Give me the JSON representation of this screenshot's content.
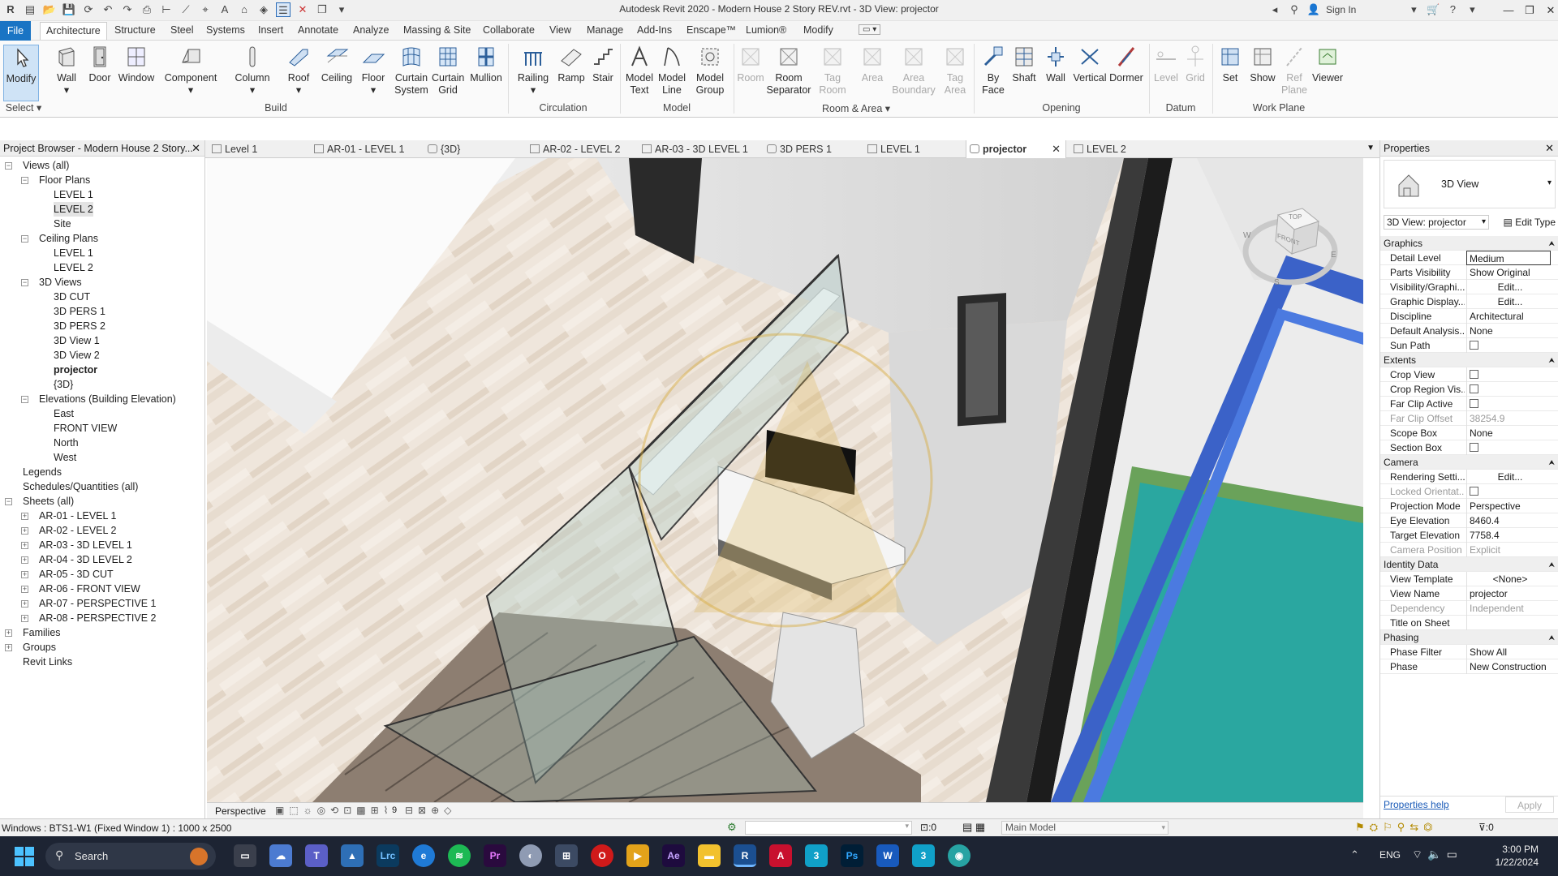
{
  "window": {
    "title": "Autodesk Revit 2020 - Modern House 2 Story REV.rvt - 3D View: projector",
    "sign_in": "Sign In"
  },
  "ribbon_tabs": [
    "File",
    "Architecture",
    "Structure",
    "Steel",
    "Systems",
    "Insert",
    "Annotate",
    "Analyze",
    "Massing & Site",
    "Collaborate",
    "View",
    "Manage",
    "Add-Ins",
    "Enscape™",
    "Lumion®",
    "Modify"
  ],
  "ribbon": {
    "buttons": [
      {
        "label": "Modify",
        "icon": "cursor-icon",
        "enabled": true
      },
      {
        "label": "Wall",
        "icon": "wall-icon",
        "enabled": true
      },
      {
        "label": "Door",
        "icon": "door-icon",
        "enabled": true
      },
      {
        "label": "Window",
        "icon": "window-icon",
        "enabled": true
      },
      {
        "label": "Component",
        "icon": "component-icon",
        "enabled": true
      },
      {
        "label": "Column",
        "icon": "column-icon",
        "enabled": true
      },
      {
        "label": "Roof",
        "icon": "roof-icon",
        "enabled": true
      },
      {
        "label": "Ceiling",
        "icon": "ceiling-icon",
        "enabled": true
      },
      {
        "label": "Floor",
        "icon": "floor-icon",
        "enabled": true
      },
      {
        "label": "Curtain\nSystem",
        "icon": "curtain-system-icon",
        "enabled": true
      },
      {
        "label": "Curtain\nGrid",
        "icon": "curtain-grid-icon",
        "enabled": true
      },
      {
        "label": "Mullion",
        "icon": "mullion-icon",
        "enabled": true
      },
      {
        "label": "Railing",
        "icon": "railing-icon",
        "enabled": true
      },
      {
        "label": "Ramp",
        "icon": "ramp-icon",
        "enabled": true
      },
      {
        "label": "Stair",
        "icon": "stair-icon",
        "enabled": true
      },
      {
        "label": "Model\nText",
        "icon": "model-text-icon",
        "enabled": true
      },
      {
        "label": "Model\nLine",
        "icon": "model-line-icon",
        "enabled": true
      },
      {
        "label": "Model\nGroup",
        "icon": "model-group-icon",
        "enabled": true
      },
      {
        "label": "Room",
        "icon": "room-icon",
        "enabled": false
      },
      {
        "label": "Room\nSeparator",
        "icon": "room-separator-icon",
        "enabled": true
      },
      {
        "label": "Tag\nRoom",
        "icon": "tag-room-icon",
        "enabled": false
      },
      {
        "label": "Area",
        "icon": "area-icon",
        "enabled": false
      },
      {
        "label": "Area\nBoundary",
        "icon": "area-boundary-icon",
        "enabled": false
      },
      {
        "label": "Tag\nArea",
        "icon": "tag-area-icon",
        "enabled": false
      },
      {
        "label": "By\nFace",
        "icon": "by-face-icon",
        "enabled": true
      },
      {
        "label": "Shaft",
        "icon": "shaft-icon",
        "enabled": true
      },
      {
        "label": "Wall",
        "icon": "wall-opening-icon",
        "enabled": true
      },
      {
        "label": "Vertical",
        "icon": "vertical-icon",
        "enabled": true
      },
      {
        "label": "Dormer",
        "icon": "dormer-icon",
        "enabled": true
      },
      {
        "label": "Level",
        "icon": "level-icon",
        "enabled": false
      },
      {
        "label": "Grid",
        "icon": "grid-icon",
        "enabled": false
      },
      {
        "label": "Set",
        "icon": "set-icon",
        "enabled": true
      },
      {
        "label": "Show",
        "icon": "show-icon",
        "enabled": true
      },
      {
        "label": "Ref\nPlane",
        "icon": "ref-plane-icon",
        "enabled": false
      },
      {
        "label": "Viewer",
        "icon": "viewer-icon",
        "enabled": true
      }
    ],
    "groups": [
      "Select ▾",
      "Build",
      "Circulation",
      "Model",
      "Room & Area ▾",
      "Opening",
      "Datum",
      "Work Plane"
    ]
  },
  "project_browser": {
    "title": "Project Browser - Modern House 2 Story...",
    "items": [
      {
        "label": "Views (all)",
        "level": 0,
        "toggle": "−"
      },
      {
        "label": "Floor Plans",
        "level": 1,
        "toggle": "−"
      },
      {
        "label": "LEVEL 1",
        "level": 2
      },
      {
        "label": "LEVEL 2",
        "level": 2,
        "selected": true
      },
      {
        "label": "Site",
        "level": 2
      },
      {
        "label": "Ceiling Plans",
        "level": 1,
        "toggle": "−"
      },
      {
        "label": "LEVEL 1",
        "level": 2
      },
      {
        "label": "LEVEL 2",
        "level": 2
      },
      {
        "label": "3D Views",
        "level": 1,
        "toggle": "−"
      },
      {
        "label": "3D CUT",
        "level": 2
      },
      {
        "label": "3D PERS 1",
        "level": 2
      },
      {
        "label": "3D PERS 2",
        "level": 2
      },
      {
        "label": "3D View 1",
        "level": 2
      },
      {
        "label": "3D View 2",
        "level": 2
      },
      {
        "label": "projector",
        "level": 2,
        "bold": true
      },
      {
        "label": "{3D}",
        "level": 2
      },
      {
        "label": "Elevations (Building Elevation)",
        "level": 1,
        "toggle": "−"
      },
      {
        "label": "East",
        "level": 2
      },
      {
        "label": "FRONT VIEW",
        "level": 2
      },
      {
        "label": "North",
        "level": 2
      },
      {
        "label": "West",
        "level": 2
      },
      {
        "label": "Legends",
        "level": 0,
        "toggle": ""
      },
      {
        "label": "Schedules/Quantities (all)",
        "level": 0,
        "toggle": ""
      },
      {
        "label": "Sheets (all)",
        "level": 0,
        "toggle": "−"
      },
      {
        "label": "AR-01 - LEVEL 1",
        "level": 1,
        "toggle": "+"
      },
      {
        "label": "AR-02 - LEVEL 2",
        "level": 1,
        "toggle": "+"
      },
      {
        "label": "AR-03 - 3D LEVEL 1",
        "level": 1,
        "toggle": "+"
      },
      {
        "label": "AR-04 - 3D LEVEL 2",
        "level": 1,
        "toggle": "+"
      },
      {
        "label": "AR-05 - 3D CUT",
        "level": 1,
        "toggle": "+"
      },
      {
        "label": "AR-06 - FRONT VIEW",
        "level": 1,
        "toggle": "+"
      },
      {
        "label": "AR-07 - PERSPECTIVE 1",
        "level": 1,
        "toggle": "+"
      },
      {
        "label": "AR-08 - PERSPECTIVE 2",
        "level": 1,
        "toggle": "+"
      },
      {
        "label": "Families",
        "level": 0,
        "toggle": "+"
      },
      {
        "label": "Groups",
        "level": 0,
        "toggle": "+"
      },
      {
        "label": "Revit Links",
        "level": 0,
        "toggle": ""
      }
    ]
  },
  "view_tabs": [
    {
      "label": "Level 1"
    },
    {
      "label": "AR-01 - LEVEL 1"
    },
    {
      "label": "{3D}"
    },
    {
      "label": "AR-02 - LEVEL 2"
    },
    {
      "label": "AR-03 - 3D LEVEL 1"
    },
    {
      "label": "3D PERS 1"
    },
    {
      "label": "LEVEL 1"
    },
    {
      "label": "projector",
      "active": true
    },
    {
      "label": "LEVEL 2"
    }
  ],
  "viewcube": {
    "top": "TOP",
    "front": "FRONT",
    "w": "W",
    "e": "E",
    "s": "S"
  },
  "properties": {
    "title": "Properties",
    "type_name": "3D View",
    "selector": "3D View: projector",
    "edit_type": "Edit Type",
    "rows": [
      {
        "group": "Graphics"
      },
      {
        "k": "Detail Level",
        "v": "Medium"
      },
      {
        "k": "Parts Visibility",
        "v": "Show Original"
      },
      {
        "k": "Visibility/Graphi...",
        "v": "Edit..."
      },
      {
        "k": "Graphic Display...",
        "v": "Edit..."
      },
      {
        "k": "Discipline",
        "v": "Architectural"
      },
      {
        "k": "Default Analysis...",
        "v": "None"
      },
      {
        "k": "Sun Path",
        "v": "",
        "cb": true
      },
      {
        "group": "Extents"
      },
      {
        "k": "Crop View",
        "v": "",
        "cb": true
      },
      {
        "k": "Crop Region Vis...",
        "v": "",
        "cb": true
      },
      {
        "k": "Far Clip Active",
        "v": "",
        "cb": true
      },
      {
        "k": "Far Clip Offset",
        "v": "38254.9",
        "dim": true
      },
      {
        "k": "Scope Box",
        "v": "None"
      },
      {
        "k": "Section Box",
        "v": "",
        "cb": true
      },
      {
        "group": "Camera"
      },
      {
        "k": "Rendering Setti...",
        "v": "Edit..."
      },
      {
        "k": "Locked Orientat...",
        "v": "",
        "cb": true,
        "dim": true
      },
      {
        "k": "Projection Mode",
        "v": "Perspective"
      },
      {
        "k": "Eye Elevation",
        "v": "8460.4"
      },
      {
        "k": "Target Elevation",
        "v": "7758.4"
      },
      {
        "k": "Camera Position",
        "v": "Explicit",
        "dim": true
      },
      {
        "group": "Identity Data"
      },
      {
        "k": "View Template",
        "v": "<None>"
      },
      {
        "k": "View Name",
        "v": "projector"
      },
      {
        "k": "Dependency",
        "v": "Independent",
        "dim": true
      },
      {
        "k": "Title on Sheet",
        "v": ""
      },
      {
        "group": "Phasing"
      },
      {
        "k": "Phase Filter",
        "v": "Show All"
      },
      {
        "k": "Phase",
        "v": "New Construction"
      }
    ],
    "help": "Properties help",
    "apply": "Apply"
  },
  "view_control_bar": {
    "mode": "Perspective",
    "count": "9"
  },
  "status": {
    "text": "Windows : BTS1-W1 (Fixed Window 1) : 1000 x 2500",
    "sel_count": ":0",
    "model": "Main Model",
    "filter_count": ":0"
  },
  "taskbar": {
    "search": "Search",
    "lang": "ENG",
    "time": "3:00 PM",
    "date": "1/22/2024",
    "apps": [
      "file-explorer",
      "onedrive",
      "teams",
      "photos",
      "lightroom",
      "edge",
      "spotify",
      "premiere",
      "vpn",
      "calc",
      "opera",
      "media",
      "after-effects",
      "folder",
      "revit",
      "autocad",
      "app-3",
      "photoshop",
      "word",
      "app-4",
      "browser"
    ]
  },
  "colors": {
    "accent": "#1a74c4",
    "taskbar": "#1d2433",
    "pool": "#2aa7a0"
  }
}
